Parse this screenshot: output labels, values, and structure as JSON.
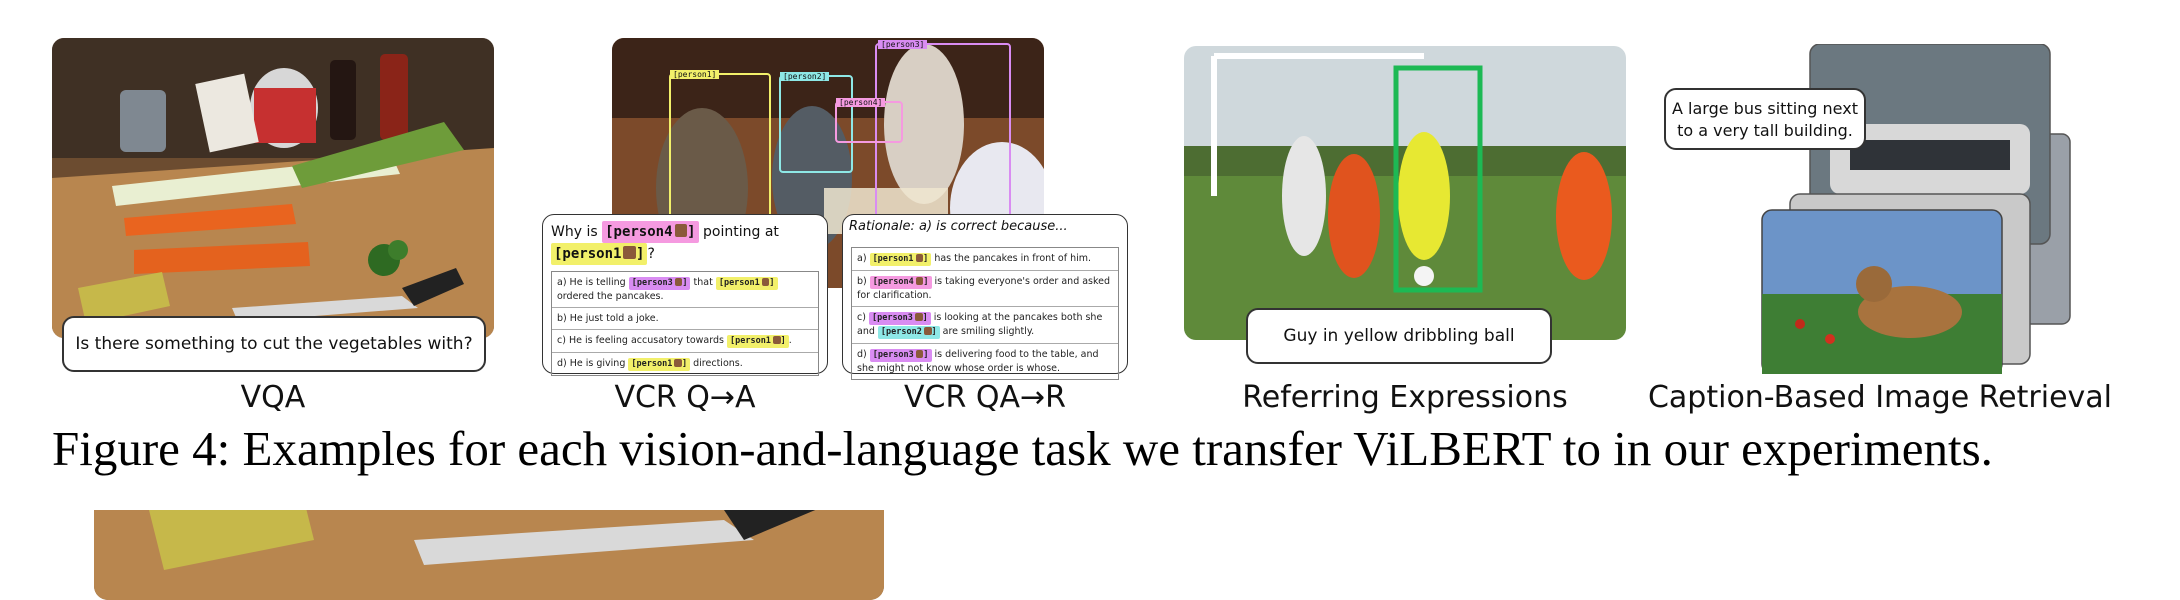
{
  "panels": {
    "vqa": {
      "question": "Is there something to cut the vegetables with?",
      "label": "VQA"
    },
    "vcr_qa": {
      "label": "VCR Q→A",
      "question_prefix": "Why is",
      "question_mid": "pointing at",
      "question_end": "?",
      "tag_a": "[person4",
      "tag_b": "[person1",
      "tag_close": "]",
      "options": [
        {
          "prefix": "a) He is telling",
          "tag1": "[person3",
          "mid": "that",
          "tag2": "[person1",
          "suffix": "ordered the pancakes."
        },
        {
          "text": "b) He just told a joke."
        },
        {
          "prefix": "c) He is feeling accusatory towards",
          "tag1": "[person1",
          "suffix": "."
        },
        {
          "prefix": "d) He is giving",
          "tag1": "[person1",
          "suffix": "directions."
        }
      ]
    },
    "vcr_qar": {
      "label": "VCR QA→R",
      "rationale": "Rationale: a) is correct because...",
      "options": [
        {
          "prefix": "a)",
          "tag1": "[person1",
          "suffix": "has the pancakes in front of him."
        },
        {
          "prefix": "b)",
          "tag1": "[person4",
          "suffix": "is taking everyone's order and asked for clarification."
        },
        {
          "prefix": "c)",
          "tag1": "[person3",
          "mid": "is looking at the pancakes both she and",
          "tag2": "[person2",
          "suffix": "are smiling slightly."
        },
        {
          "prefix": "d)",
          "tag1": "[person3",
          "suffix": "is delivering food to the table, and she might not know whose order is whose."
        }
      ]
    },
    "vcr_boxes": [
      "[person1]",
      "[person2]",
      "[person3]",
      "[person4]"
    ],
    "ref": {
      "expression": "Guy in yellow dribbling ball",
      "label": "Referring Expressions"
    },
    "retrieval": {
      "query_line1": "A large bus sitting next",
      "query_line2": "to a very tall building.",
      "label": "Caption-Based Image Retrieval"
    }
  },
  "figure_caption": "Figure 4: Examples for each vision-and-language task we transfer ViLBERT to in our experiments.",
  "colors": {
    "person1": "#f2f06a",
    "person2": "#8ee8e6",
    "person3": "#d98cf2",
    "person4": "#f59ae0",
    "ref_box": "#1db954"
  }
}
